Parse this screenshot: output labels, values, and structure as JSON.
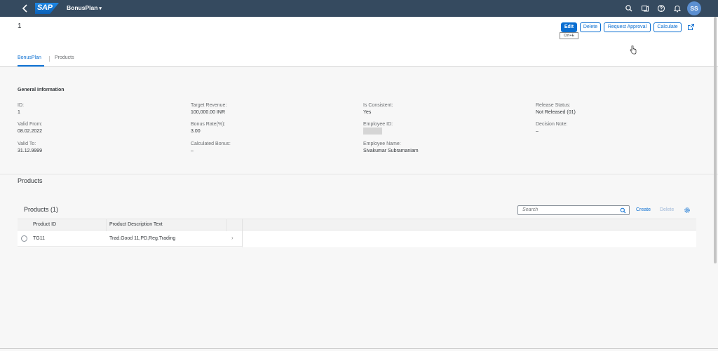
{
  "shell": {
    "logo": "SAP",
    "app_title": "BonusPlan",
    "avatar_initials": "SS",
    "icons": [
      "back-icon",
      "search-icon",
      "notifications-list-icon",
      "help-icon",
      "bell-icon"
    ]
  },
  "header": {
    "object_title": "1",
    "buttons": {
      "edit": "Edit",
      "delete": "Delete",
      "request_approval": "Request Approval",
      "calculate": "Calculate"
    },
    "edit_tooltip": "Ctrl+E"
  },
  "tabs": [
    {
      "label": "BonusPlan",
      "selected": true
    },
    {
      "label": "Products",
      "selected": false
    }
  ],
  "general_info": {
    "title": "General Information",
    "fields": {
      "id": {
        "label": "ID:",
        "value": "1"
      },
      "valid_from": {
        "label": "Valid From:",
        "value": "08.02.2022"
      },
      "valid_to": {
        "label": "Valid To:",
        "value": "31.12.9999"
      },
      "target_revenue": {
        "label": "Target Revenue:",
        "value": "100,000.00  INR"
      },
      "bonus_rate": {
        "label": "Bonus Rate(%):",
        "value": "3.00"
      },
      "calculated_bonus": {
        "label": "Calculated Bonus:",
        "value": "–"
      },
      "is_consistent": {
        "label": "Is Consistent:",
        "value": "Yes"
      },
      "employee_id": {
        "label": "Employee ID:",
        "value": ""
      },
      "employee_name": {
        "label": "Employee Name:",
        "value": "Sivakumar Subramaniam"
      },
      "release_status": {
        "label": "Release Status:",
        "value": "Not Released (01)"
      },
      "decision_note": {
        "label": "Decision Note:",
        "value": "–"
      }
    }
  },
  "products_section": {
    "title": "Products",
    "table_title": "Products (1)",
    "search_placeholder": "Search",
    "actions": {
      "create": "Create",
      "delete": "Delete"
    },
    "columns": [
      "Product ID",
      "Product Description Text"
    ],
    "rows": [
      {
        "product_id": "TG11",
        "description": "Trad.Good 11,PD,Reg.Trading"
      }
    ]
  },
  "colors": {
    "shell_bg": "#354a5f",
    "accent": "#0a6ed1",
    "avatar": "#5b8fd1"
  }
}
